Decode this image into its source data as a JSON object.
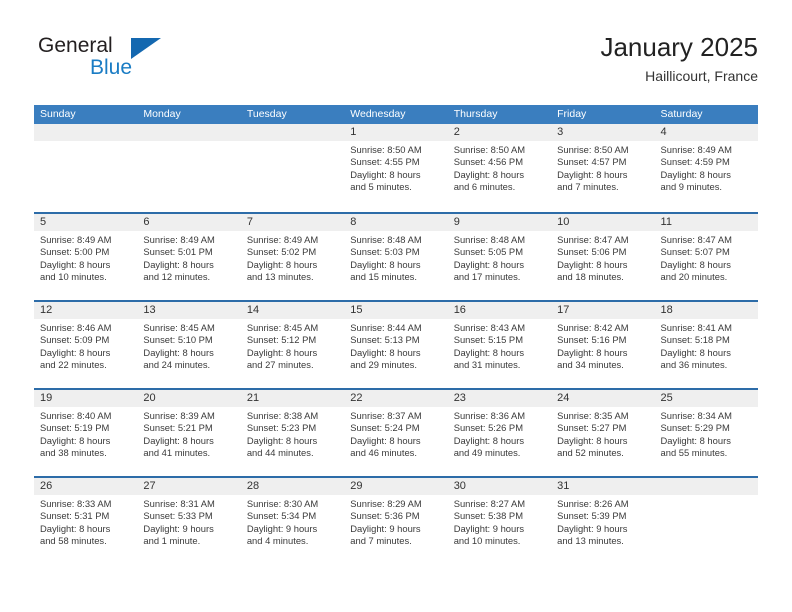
{
  "brand": {
    "name_top": "General",
    "name_bottom": "Blue",
    "triangle_color": "#1468b0"
  },
  "header": {
    "title": "January 2025",
    "location": "Haillicourt, France"
  },
  "colors": {
    "header_bar": "#3a7ebf",
    "row_divider": "#2d6ca8",
    "date_band": "#efefef",
    "brand_blue": "#1a7cc4"
  },
  "weekdays": [
    "Sunday",
    "Monday",
    "Tuesday",
    "Wednesday",
    "Thursday",
    "Friday",
    "Saturday"
  ],
  "weeks": [
    [
      {
        "day": "",
        "lines": []
      },
      {
        "day": "",
        "lines": []
      },
      {
        "day": "",
        "lines": []
      },
      {
        "day": "1",
        "lines": [
          "Sunrise: 8:50 AM",
          "Sunset: 4:55 PM",
          "Daylight: 8 hours",
          "and 5 minutes."
        ]
      },
      {
        "day": "2",
        "lines": [
          "Sunrise: 8:50 AM",
          "Sunset: 4:56 PM",
          "Daylight: 8 hours",
          "and 6 minutes."
        ]
      },
      {
        "day": "3",
        "lines": [
          "Sunrise: 8:50 AM",
          "Sunset: 4:57 PM",
          "Daylight: 8 hours",
          "and 7 minutes."
        ]
      },
      {
        "day": "4",
        "lines": [
          "Sunrise: 8:49 AM",
          "Sunset: 4:59 PM",
          "Daylight: 8 hours",
          "and 9 minutes."
        ]
      }
    ],
    [
      {
        "day": "5",
        "lines": [
          "Sunrise: 8:49 AM",
          "Sunset: 5:00 PM",
          "Daylight: 8 hours",
          "and 10 minutes."
        ]
      },
      {
        "day": "6",
        "lines": [
          "Sunrise: 8:49 AM",
          "Sunset: 5:01 PM",
          "Daylight: 8 hours",
          "and 12 minutes."
        ]
      },
      {
        "day": "7",
        "lines": [
          "Sunrise: 8:49 AM",
          "Sunset: 5:02 PM",
          "Daylight: 8 hours",
          "and 13 minutes."
        ]
      },
      {
        "day": "8",
        "lines": [
          "Sunrise: 8:48 AM",
          "Sunset: 5:03 PM",
          "Daylight: 8 hours",
          "and 15 minutes."
        ]
      },
      {
        "day": "9",
        "lines": [
          "Sunrise: 8:48 AM",
          "Sunset: 5:05 PM",
          "Daylight: 8 hours",
          "and 17 minutes."
        ]
      },
      {
        "day": "10",
        "lines": [
          "Sunrise: 8:47 AM",
          "Sunset: 5:06 PM",
          "Daylight: 8 hours",
          "and 18 minutes."
        ]
      },
      {
        "day": "11",
        "lines": [
          "Sunrise: 8:47 AM",
          "Sunset: 5:07 PM",
          "Daylight: 8 hours",
          "and 20 minutes."
        ]
      }
    ],
    [
      {
        "day": "12",
        "lines": [
          "Sunrise: 8:46 AM",
          "Sunset: 5:09 PM",
          "Daylight: 8 hours",
          "and 22 minutes."
        ]
      },
      {
        "day": "13",
        "lines": [
          "Sunrise: 8:45 AM",
          "Sunset: 5:10 PM",
          "Daylight: 8 hours",
          "and 24 minutes."
        ]
      },
      {
        "day": "14",
        "lines": [
          "Sunrise: 8:45 AM",
          "Sunset: 5:12 PM",
          "Daylight: 8 hours",
          "and 27 minutes."
        ]
      },
      {
        "day": "15",
        "lines": [
          "Sunrise: 8:44 AM",
          "Sunset: 5:13 PM",
          "Daylight: 8 hours",
          "and 29 minutes."
        ]
      },
      {
        "day": "16",
        "lines": [
          "Sunrise: 8:43 AM",
          "Sunset: 5:15 PM",
          "Daylight: 8 hours",
          "and 31 minutes."
        ]
      },
      {
        "day": "17",
        "lines": [
          "Sunrise: 8:42 AM",
          "Sunset: 5:16 PM",
          "Daylight: 8 hours",
          "and 34 minutes."
        ]
      },
      {
        "day": "18",
        "lines": [
          "Sunrise: 8:41 AM",
          "Sunset: 5:18 PM",
          "Daylight: 8 hours",
          "and 36 minutes."
        ]
      }
    ],
    [
      {
        "day": "19",
        "lines": [
          "Sunrise: 8:40 AM",
          "Sunset: 5:19 PM",
          "Daylight: 8 hours",
          "and 38 minutes."
        ]
      },
      {
        "day": "20",
        "lines": [
          "Sunrise: 8:39 AM",
          "Sunset: 5:21 PM",
          "Daylight: 8 hours",
          "and 41 minutes."
        ]
      },
      {
        "day": "21",
        "lines": [
          "Sunrise: 8:38 AM",
          "Sunset: 5:23 PM",
          "Daylight: 8 hours",
          "and 44 minutes."
        ]
      },
      {
        "day": "22",
        "lines": [
          "Sunrise: 8:37 AM",
          "Sunset: 5:24 PM",
          "Daylight: 8 hours",
          "and 46 minutes."
        ]
      },
      {
        "day": "23",
        "lines": [
          "Sunrise: 8:36 AM",
          "Sunset: 5:26 PM",
          "Daylight: 8 hours",
          "and 49 minutes."
        ]
      },
      {
        "day": "24",
        "lines": [
          "Sunrise: 8:35 AM",
          "Sunset: 5:27 PM",
          "Daylight: 8 hours",
          "and 52 minutes."
        ]
      },
      {
        "day": "25",
        "lines": [
          "Sunrise: 8:34 AM",
          "Sunset: 5:29 PM",
          "Daylight: 8 hours",
          "and 55 minutes."
        ]
      }
    ],
    [
      {
        "day": "26",
        "lines": [
          "Sunrise: 8:33 AM",
          "Sunset: 5:31 PM",
          "Daylight: 8 hours",
          "and 58 minutes."
        ]
      },
      {
        "day": "27",
        "lines": [
          "Sunrise: 8:31 AM",
          "Sunset: 5:33 PM",
          "Daylight: 9 hours",
          "and 1 minute."
        ]
      },
      {
        "day": "28",
        "lines": [
          "Sunrise: 8:30 AM",
          "Sunset: 5:34 PM",
          "Daylight: 9 hours",
          "and 4 minutes."
        ]
      },
      {
        "day": "29",
        "lines": [
          "Sunrise: 8:29 AM",
          "Sunset: 5:36 PM",
          "Daylight: 9 hours",
          "and 7 minutes."
        ]
      },
      {
        "day": "30",
        "lines": [
          "Sunrise: 8:27 AM",
          "Sunset: 5:38 PM",
          "Daylight: 9 hours",
          "and 10 minutes."
        ]
      },
      {
        "day": "31",
        "lines": [
          "Sunrise: 8:26 AM",
          "Sunset: 5:39 PM",
          "Daylight: 9 hours",
          "and 13 minutes."
        ]
      },
      {
        "day": "",
        "lines": []
      }
    ]
  ]
}
